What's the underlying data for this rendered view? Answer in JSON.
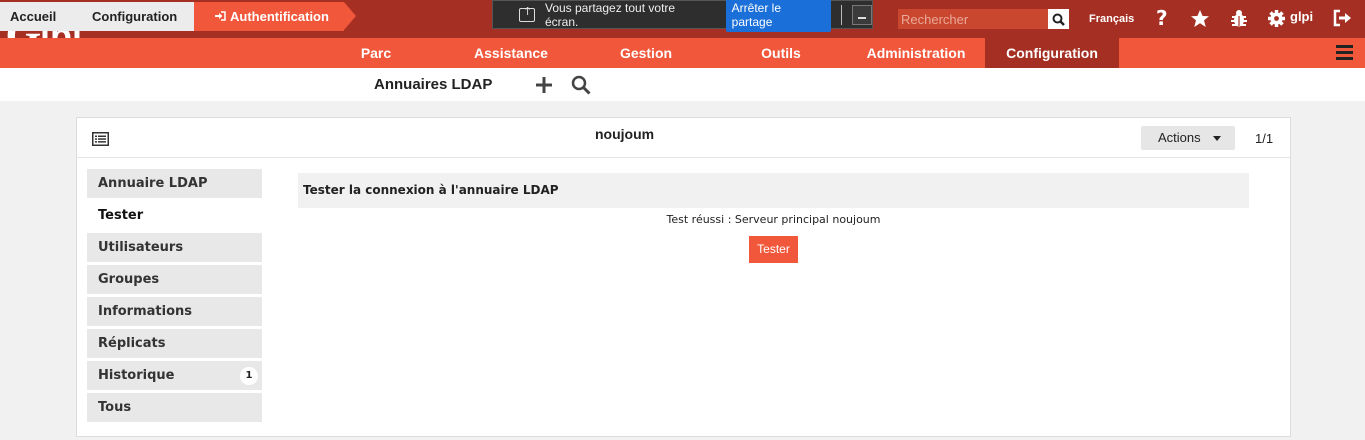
{
  "app": {
    "logo_text": "Glpi"
  },
  "screen_share": {
    "message": "Vous partagez tout votre écran.",
    "stop_label": "Arrêter le partage"
  },
  "header": {
    "search_placeholder": "Rechercher",
    "language": "Français",
    "user": "glpi",
    "icons": [
      "search-icon",
      "help-icon",
      "star-icon",
      "bug-icon",
      "gear-icon",
      "logout-icon"
    ]
  },
  "menu": {
    "items": [
      {
        "label": "Parc"
      },
      {
        "label": "Assistance"
      },
      {
        "label": "Gestion"
      },
      {
        "label": "Outils"
      },
      {
        "label": "Administration"
      },
      {
        "label": "Configuration",
        "active": true
      }
    ]
  },
  "breadcrumb": {
    "items": [
      "Accueil",
      "Configuration",
      "Authentification"
    ],
    "page_title": "Annuaires LDAP"
  },
  "record": {
    "name": "noujoum",
    "actions_label": "Actions",
    "pager": "1/1"
  },
  "tabs": [
    {
      "label": "Annuaire LDAP"
    },
    {
      "label": "Tester",
      "active": true
    },
    {
      "label": "Utilisateurs"
    },
    {
      "label": "Groupes"
    },
    {
      "label": "Informations avancées"
    },
    {
      "label": "Réplicats"
    },
    {
      "label": "Historique",
      "badge": "1"
    },
    {
      "label": "Tous"
    }
  ],
  "content": {
    "heading": "Tester la connexion à l'annuaire LDAP",
    "result": "Test réussi : Serveur principal noujoum",
    "button_label": "Tester"
  },
  "colors": {
    "top_bar": "#a52f22",
    "menu_bar": "#f1573b",
    "accent": "#f1573b",
    "share_button": "#1a6fd8"
  }
}
